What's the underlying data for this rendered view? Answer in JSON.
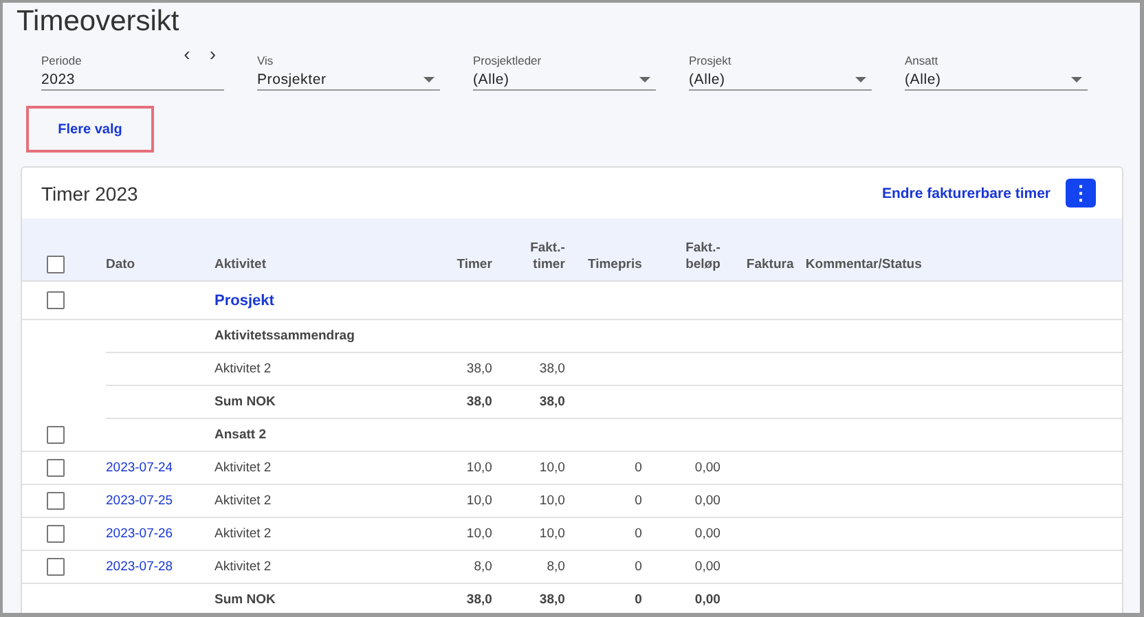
{
  "page_title": "Timeoversikt",
  "filters": [
    {
      "kind": "period",
      "label": "Periode",
      "value": "2023",
      "prev": "‹",
      "next": "›"
    },
    {
      "kind": "select",
      "label": "Vis",
      "value": "Prosjekter"
    },
    {
      "kind": "select",
      "label": "Prosjektleder",
      "value": "(Alle)"
    },
    {
      "kind": "select",
      "label": "Prosjekt",
      "value": "(Alle)"
    },
    {
      "kind": "select",
      "label": "Ansatt",
      "value": "(Alle)"
    }
  ],
  "more_options": {
    "label": "Flere valg",
    "focused": true
  },
  "card": {
    "title": "Timer 2023",
    "action": "Endre fakturerbare timer",
    "menu": "⋮"
  },
  "table": {
    "header_checked": false,
    "columns": [
      "Dato",
      "Aktivitet",
      "Timer",
      "Fakt.-timer",
      "Timepris",
      "Fakt.-beløp",
      "Faktura",
      "Kommentar/Status"
    ],
    "rows": [
      {
        "kind": "group",
        "checked": false,
        "activity": "Prosjekt"
      },
      {
        "kind": "section",
        "activity": "Aktivitetssammendrag"
      },
      {
        "kind": "line",
        "activity": "Aktivitet 2",
        "timer": "38,0",
        "fakt_timer": "38,0"
      },
      {
        "kind": "sum",
        "activity": "Sum NOK",
        "timer": "38,0",
        "fakt_timer": "38,0"
      },
      {
        "kind": "employee",
        "checked": false,
        "activity": "Ansatt 2"
      },
      {
        "kind": "entry",
        "checked": false,
        "date": "2023-07-24",
        "activity": "Aktivitet 2",
        "timer": "10,0",
        "fakt_timer": "10,0",
        "timepris": "0",
        "fakt_belop": "0,00"
      },
      {
        "kind": "entry",
        "checked": false,
        "date": "2023-07-25",
        "activity": "Aktivitet 2",
        "timer": "10,0",
        "fakt_timer": "10,0",
        "timepris": "0",
        "fakt_belop": "0,00"
      },
      {
        "kind": "entry",
        "checked": false,
        "date": "2023-07-26",
        "activity": "Aktivitet 2",
        "timer": "10,0",
        "fakt_timer": "10,0",
        "timepris": "0",
        "fakt_belop": "0,00"
      },
      {
        "kind": "entry",
        "checked": false,
        "date": "2023-07-28",
        "activity": "Aktivitet 2",
        "timer": "8,0",
        "fakt_timer": "8,0",
        "timepris": "0",
        "fakt_belop": "0,00"
      },
      {
        "kind": "sum",
        "activity": "Sum NOK",
        "timer": "38,0",
        "fakt_timer": "38,0",
        "timepris": "0",
        "fakt_belop": "0,00"
      }
    ]
  }
}
